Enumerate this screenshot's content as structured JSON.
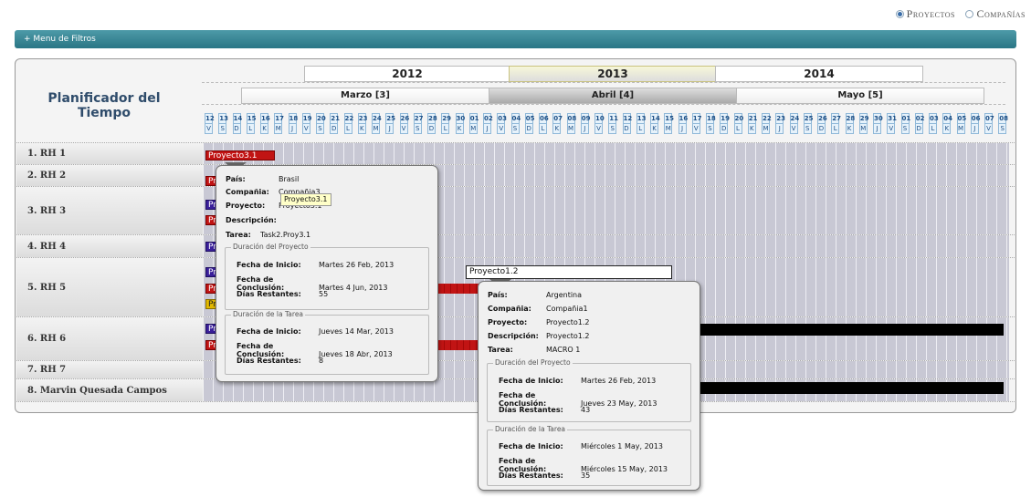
{
  "top_links": {
    "projects": "Proyectos",
    "companies": "Compañías"
  },
  "filter_bar": {
    "label": "+ Menu de Filtros"
  },
  "planner": {
    "title": "Planificador del Tiempo"
  },
  "years": [
    "2012",
    "2013",
    "2014"
  ],
  "months": [
    "Marzo [3]",
    "Abril [4]",
    "Mayo [5]"
  ],
  "day_numbers": [
    "12",
    "13",
    "14",
    "15",
    "16",
    "17",
    "18",
    "19",
    "20",
    "21",
    "22",
    "23",
    "24",
    "25",
    "26",
    "27",
    "28",
    "29",
    "30",
    "01",
    "02",
    "03",
    "04",
    "05",
    "06",
    "07",
    "08",
    "09",
    "10",
    "11",
    "12",
    "13",
    "14",
    "15",
    "16",
    "17",
    "18",
    "19",
    "20",
    "21",
    "22",
    "23",
    "24",
    "25",
    "26",
    "27",
    "28",
    "29",
    "30",
    "31",
    "01",
    "02",
    "03",
    "04",
    "05",
    "06",
    "07",
    "08"
  ],
  "day_letters": [
    "V",
    "S",
    "D",
    "L",
    "K",
    "M",
    "J",
    "V",
    "S",
    "D",
    "L",
    "K",
    "M",
    "J",
    "V",
    "S",
    "D",
    "L",
    "K",
    "M",
    "J",
    "V",
    "S",
    "D",
    "L",
    "K",
    "M",
    "J",
    "V",
    "S",
    "D",
    "L",
    "K",
    "M",
    "J",
    "V",
    "S",
    "D",
    "L",
    "K",
    "M",
    "J",
    "V",
    "S",
    "D",
    "L",
    "K",
    "M",
    "J",
    "V",
    "S",
    "D",
    "L",
    "K",
    "M",
    "J",
    "V",
    "S"
  ],
  "rows": [
    "1. RH 1",
    "2. RH 2",
    "3. RH 3",
    "4. RH 4",
    "5. RH 5",
    "6. RH 6",
    "7. RH 7",
    "8. Marvin Quesada Campos"
  ],
  "bars": {
    "rh1": "Proyecto3.1",
    "short": "Pr",
    "rh5_hover": "Proyecto1.2"
  },
  "tooltip1": {
    "pais_label": "País:",
    "pais": "Brasil",
    "compania_label": "Compañia:",
    "compania": "Compañia3",
    "proyecto_label": "Proyecto:",
    "proyecto": "Proyecto3.1",
    "descripcion_label": "Descripción:",
    "descripcion": "",
    "tarea_label": "Tarea:",
    "tarea": "Task2.Proy3.1",
    "proj_legend": "Duración del Proyecto",
    "inicio_label": "Fecha de Inicio:",
    "proj_inicio": "Martes 26 Feb, 2013",
    "conclusion_label": "Fecha de Conclusión:",
    "proj_conclusion": "Martes 4 Jun, 2013",
    "restantes_label": "Días Restantes:",
    "proj_restantes": "55",
    "task_legend": "Duración de la Tarea",
    "task_inicio": "Jueves 14 Mar, 2013",
    "task_conclusion": "Jueves 18 Abr, 2013",
    "task_restantes": "8",
    "yellow_tag": "Proyecto3.1"
  },
  "tooltip2": {
    "pais": "Argentina",
    "compania": "Compañia1",
    "proyecto": "Proyecto1.2",
    "descripcion": "Proyecto1.2",
    "tarea": "MACRO 1",
    "proj_inicio": "Martes 26 Feb, 2013",
    "proj_conclusion": "Jueves 23 May, 2013",
    "proj_restantes": "43",
    "task_inicio": "Miércoles 1 May, 2013",
    "task_conclusion": "Miércoles 15 May, 2013",
    "task_restantes": "35"
  }
}
